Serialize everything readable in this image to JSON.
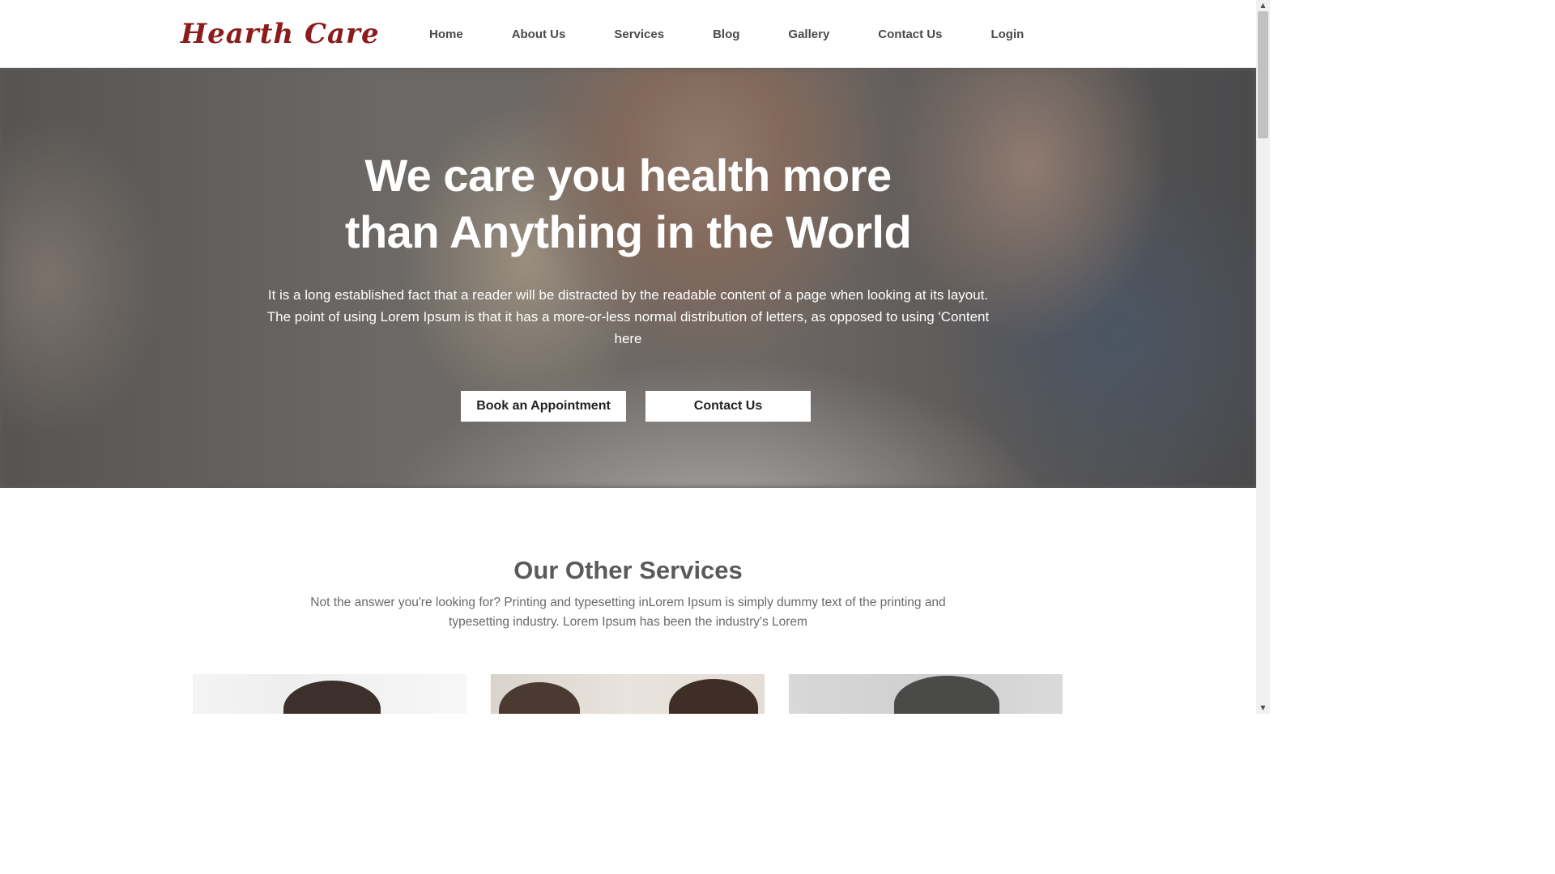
{
  "header": {
    "logo_text": "Hearth Care",
    "nav": [
      "Home",
      "About Us",
      "Services",
      "Blog",
      "Gallery",
      "Contact Us",
      "Login"
    ]
  },
  "hero": {
    "title_line1": "We care you health more",
    "title_line2": "than Anything in the World",
    "text": "It is a long established fact that a reader will be distracted by the readable content of a page when looking at its layout. The point of using Lorem Ipsum is that it has a more-or-less normal distribution of letters, as opposed to using 'Content here",
    "book_button": "Book an Appointment",
    "contact_button": "Contact Us"
  },
  "services": {
    "title": "Our Other Services",
    "text": "Not the answer you're looking for? Printing and typesetting inLorem Ipsum is simply dummy text of the printing and typesetting industry. Lorem Ipsum has been the industry's Lorem"
  },
  "icons": {
    "scroll_up": "▲",
    "scroll_down": "▼"
  },
  "colors": {
    "logo": "#8b1c1c",
    "nav_text": "#4a4a4a",
    "hero_text": "#ffffff"
  }
}
